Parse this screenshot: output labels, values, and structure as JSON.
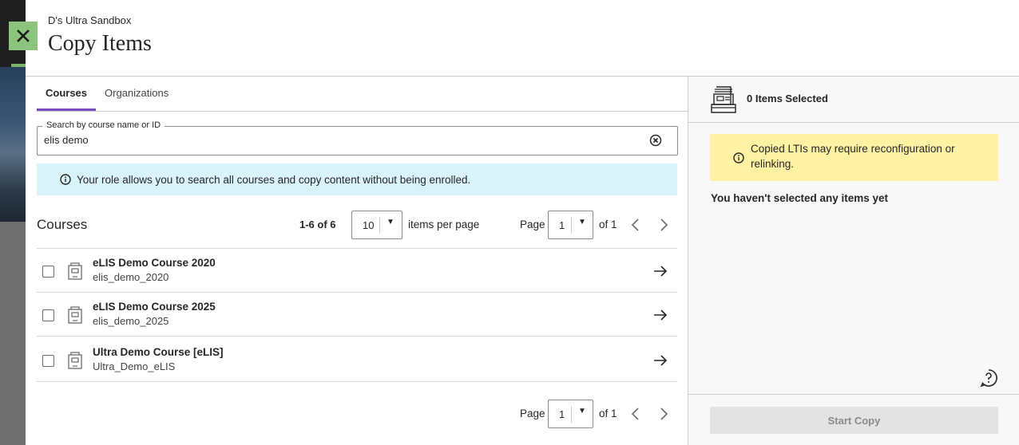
{
  "header": {
    "subtitle": "D's Ultra Sandbox",
    "title": "Copy Items"
  },
  "tabs": [
    {
      "label": "Courses",
      "active": true
    },
    {
      "label": "Organizations",
      "active": false
    }
  ],
  "search": {
    "label": "Search by course name or ID",
    "value": "elis demo"
  },
  "info_banner": {
    "text": "Your role allows you to search all courses and copy content without being enrolled."
  },
  "courses": {
    "heading": "Courses",
    "count_text": "1-6 of 6",
    "per_page_value": "10",
    "per_page_label": "items per page",
    "page_label": "Page",
    "page_value": "1",
    "of_label": "of 1",
    "items": [
      {
        "name": "eLIS Demo Course 2020",
        "id": "elis_demo_2020"
      },
      {
        "name": "eLIS Demo Course 2025",
        "id": "elis_demo_2025"
      },
      {
        "name": "Ultra Demo Course [eLIS]",
        "id": "Ultra_Demo_eLIS"
      }
    ]
  },
  "bottom_pagination": {
    "page_label": "Page",
    "page_value": "1",
    "of_label": "of 1"
  },
  "selection": {
    "count_text": "0 Items Selected",
    "warning": "Copied LTIs may require reconfiguration or relinking.",
    "empty_text": "You haven't selected any items yet",
    "start_button": "Start Copy"
  },
  "colors": {
    "close_button": "#8cc37d",
    "active_tab": "#7b4fbf",
    "info_bg": "#d9f3fa",
    "warning_bg": "#fff3a3"
  }
}
